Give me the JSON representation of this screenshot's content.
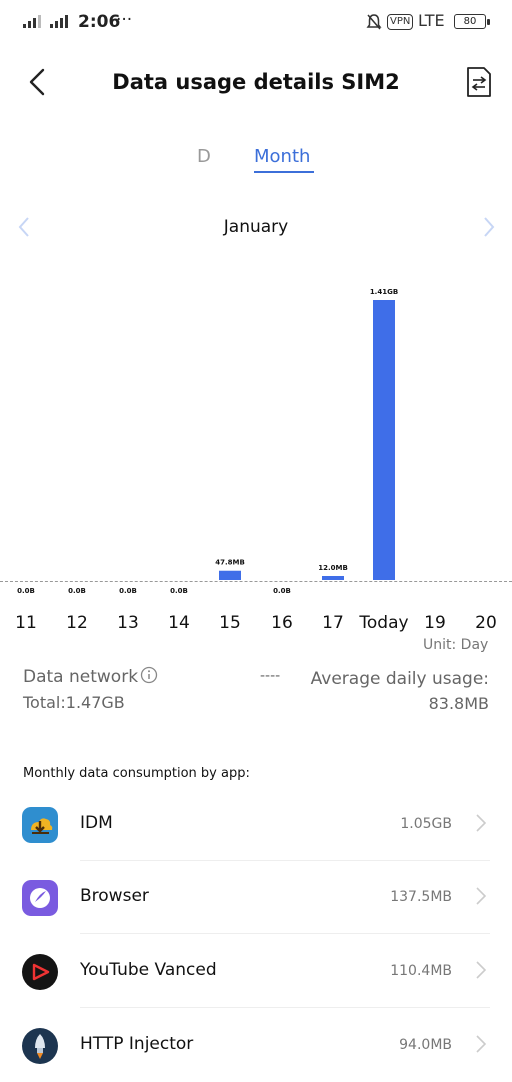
{
  "status_bar": {
    "time": "2:06",
    "dots": "···",
    "vpn": "VPN",
    "network": "LTE",
    "battery": "80"
  },
  "header": {
    "title": "Data usage details SIM2"
  },
  "tabs": {
    "day": "D",
    "month": "Month"
  },
  "period": {
    "label": "January"
  },
  "chart_data": {
    "type": "bar",
    "categories": [
      "11",
      "12",
      "13",
      "14",
      "15",
      "16",
      "17",
      "Today",
      "19",
      "20"
    ],
    "values_mb": [
      0,
      0,
      0,
      0,
      47.8,
      0,
      12.0,
      1443.84,
      null,
      null
    ],
    "data_labels": [
      "0.0B",
      "0.0B",
      "0.0B",
      "0.0B",
      "47.8MB",
      "0.0B",
      "12.0MB",
      "1.41GB",
      "",
      ""
    ],
    "unit_label": "Unit: Day",
    "bar_color": "#3f6ee8"
  },
  "summary": {
    "network_label": "Data network",
    "total": "Total:1.47GB",
    "separator": "----",
    "avg_label": "Average daily usage:",
    "avg_value": "83.8MB"
  },
  "apps_section": {
    "title": "Monthly data consumption by app:",
    "apps": [
      {
        "name": "IDM",
        "usage": "1.05GB",
        "icon": "idm-icon"
      },
      {
        "name": "Browser",
        "usage": "137.5MB",
        "icon": "browser-icon"
      },
      {
        "name": "YouTube Vanced",
        "usage": "110.4MB",
        "icon": "youtube-vanced-icon"
      },
      {
        "name": "HTTP Injector",
        "usage": "94.0MB",
        "icon": "http-injector-icon"
      }
    ]
  }
}
